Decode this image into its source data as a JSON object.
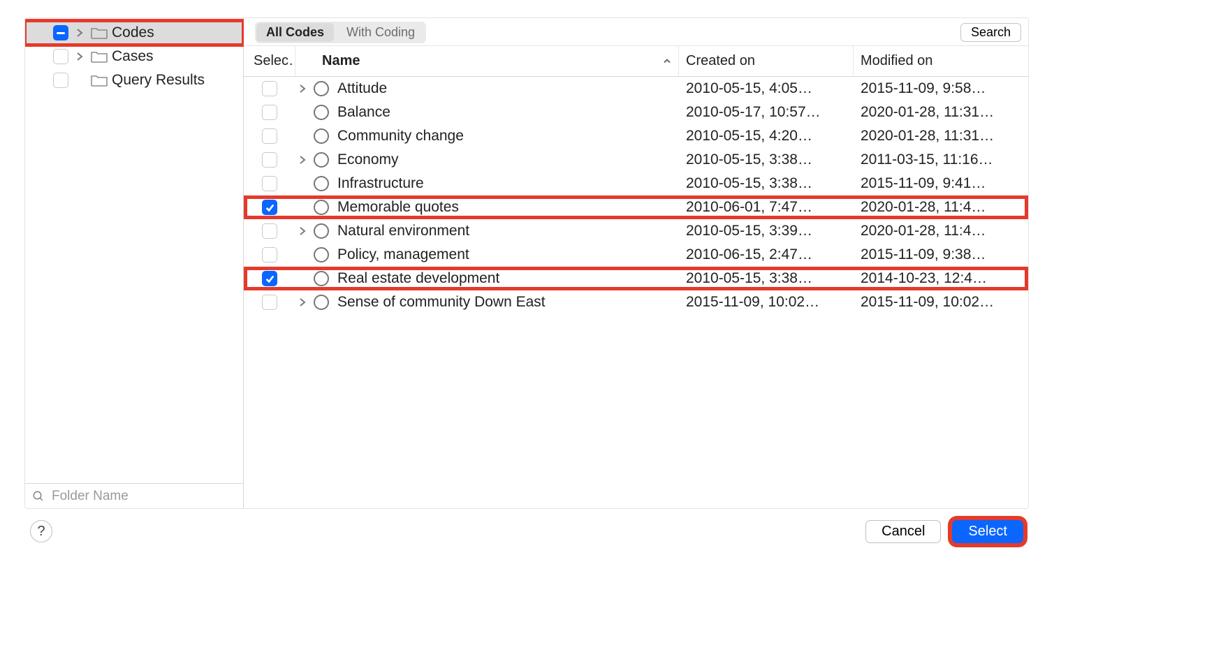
{
  "sidebar": {
    "items": [
      {
        "label": "Codes",
        "mixed": true,
        "expandable": true,
        "selected": true,
        "highlighted": true
      },
      {
        "label": "Cases",
        "mixed": false,
        "expandable": true,
        "selected": false,
        "highlighted": false
      },
      {
        "label": "Query Results",
        "mixed": false,
        "expandable": false,
        "selected": false,
        "highlighted": false
      }
    ],
    "search_placeholder": "Folder Name"
  },
  "toolbar": {
    "seg_all_label": "All Codes",
    "seg_with_coding_label": "With Coding",
    "active_segment": 0,
    "search_label": "Search"
  },
  "columns": {
    "select": "Selec…",
    "name": "Name",
    "created": "Created on",
    "modified": "Modified on",
    "sort_column": "name",
    "sort_dir": "asc"
  },
  "rows": [
    {
      "checked": false,
      "expandable": true,
      "name": "Attitude",
      "created": "2010-05-15, 4:05…",
      "modified": "2015-11-09, 9:58…",
      "highlighted": false
    },
    {
      "checked": false,
      "expandable": false,
      "name": "Balance",
      "created": "2010-05-17, 10:57…",
      "modified": "2020-01-28, 11:31…",
      "highlighted": false
    },
    {
      "checked": false,
      "expandable": false,
      "name": "Community change",
      "created": "2010-05-15, 4:20…",
      "modified": "2020-01-28, 11:31…",
      "highlighted": false
    },
    {
      "checked": false,
      "expandable": true,
      "name": "Economy",
      "created": "2010-05-15, 3:38…",
      "modified": "2011-03-15, 11:16…",
      "highlighted": false
    },
    {
      "checked": false,
      "expandable": false,
      "name": "Infrastructure",
      "created": "2010-05-15, 3:38…",
      "modified": "2015-11-09, 9:41…",
      "highlighted": false
    },
    {
      "checked": true,
      "expandable": false,
      "name": "Memorable quotes",
      "created": "2010-06-01, 7:47…",
      "modified": "2020-01-28, 11:4…",
      "highlighted": true
    },
    {
      "checked": false,
      "expandable": true,
      "name": "Natural environment",
      "created": "2010-05-15, 3:39…",
      "modified": "2020-01-28, 11:4…",
      "highlighted": false
    },
    {
      "checked": false,
      "expandable": false,
      "name": "Policy, management",
      "created": "2010-06-15, 2:47…",
      "modified": "2015-11-09, 9:38…",
      "highlighted": false
    },
    {
      "checked": true,
      "expandable": false,
      "name": "Real estate development",
      "created": "2010-05-15, 3:38…",
      "modified": "2014-10-23, 12:4…",
      "highlighted": true
    },
    {
      "checked": false,
      "expandable": true,
      "name": "Sense of community Down East",
      "created": "2015-11-09, 10:02…",
      "modified": "2015-11-09, 10:02…",
      "highlighted": false
    }
  ],
  "footer": {
    "help_label": "?",
    "cancel_label": "Cancel",
    "select_label": "Select",
    "select_highlighted": true
  }
}
